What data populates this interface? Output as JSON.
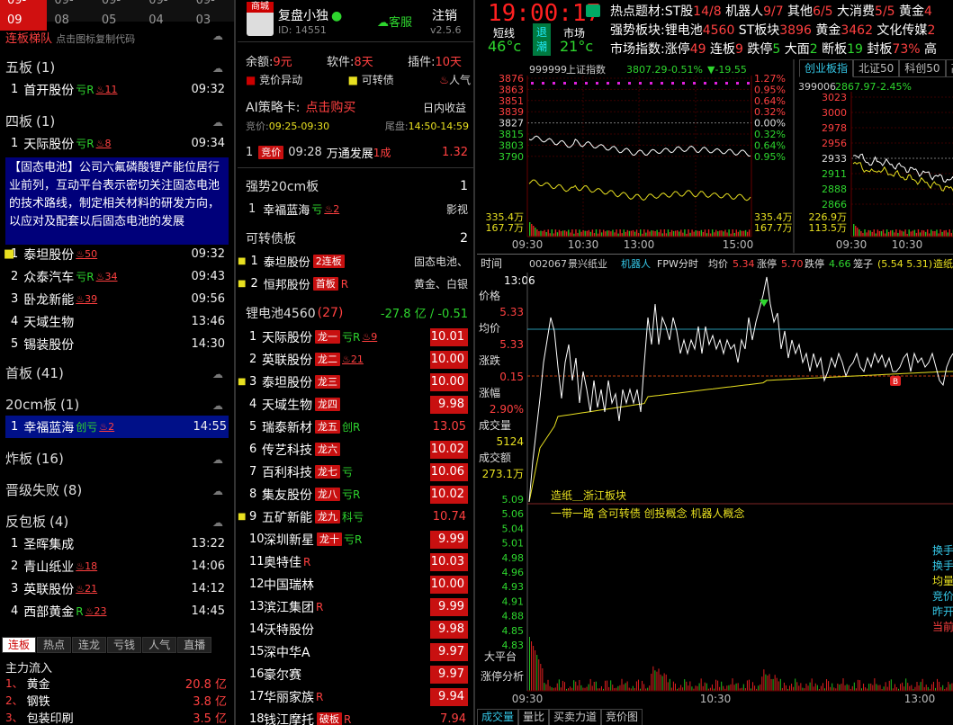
{
  "dates": [
    "09-09",
    "09-08",
    "09-05",
    "09-04",
    "09-03"
  ],
  "left": {
    "title": "连板梯队",
    "hint": "点击图标复制代码",
    "sections": [
      {
        "label": "五板",
        "count": "(1)",
        "items": [
          {
            "n": "1",
            "name": "首开股份",
            "flags": "亏R",
            "hot": "11",
            "time": "09:32"
          }
        ]
      },
      {
        "label": "四板",
        "count": "(1)",
        "items": [
          {
            "n": "1",
            "name": "天际股份",
            "flags": "亏R",
            "hot": "8",
            "time": "09:34"
          }
        ]
      },
      {
        "label": "三板",
        "count": "",
        "items": [
          {
            "n": "1",
            "name": "泰坦股份",
            "flags": "",
            "hot": "50",
            "time": "09:32"
          },
          {
            "n": "2",
            "name": "众泰汽车",
            "flags": "亏R",
            "hot": "34",
            "time": "09:43"
          },
          {
            "n": "3",
            "name": "卧龙新能",
            "flags": "",
            "hot": "39",
            "time": "09:56"
          },
          {
            "n": "4",
            "name": "天域生物",
            "flags": "",
            "hot": "",
            "time": "13:46"
          },
          {
            "n": "5",
            "name": "锡装股份",
            "flags": "",
            "hot": "",
            "time": "14:30"
          }
        ]
      },
      {
        "label": "首板",
        "count": "(41)"
      },
      {
        "label": "20cm板",
        "count": "(1)",
        "items": [
          {
            "n": "1",
            "name": "幸福蓝海",
            "flags": "创亏",
            "hot": "2",
            "time": "14:55"
          }
        ]
      },
      {
        "label": "炸板",
        "count": "(16)"
      },
      {
        "label": "晋级失败",
        "count": "(8)"
      },
      {
        "label": "反包板",
        "count": "(4)",
        "items": [
          {
            "n": "1",
            "name": "圣晖集成",
            "flags": "",
            "hot": "",
            "time": "13:22"
          },
          {
            "n": "2",
            "name": "青山纸业",
            "flags": "",
            "hot": "18",
            "time": "14:06"
          },
          {
            "n": "3",
            "name": "英联股份",
            "flags": "",
            "hot": "21",
            "time": "14:12"
          },
          {
            "n": "4",
            "name": "西部黄金",
            "flags": "R",
            "hot": "23",
            "time": "14:45"
          }
        ]
      }
    ],
    "tooltip": "【固态电池】公司六氟磷酸锂产能位居行业前列，互动平台表示密切关注固态电池的技术路线，制定相关材料的研发方向，以应对及配套以后固态电池的发展",
    "tabs": [
      "连板",
      "热点",
      "连龙",
      "亏钱",
      "人气",
      "直播"
    ],
    "flow_title": "主力流入",
    "flows": [
      {
        "n": "1、",
        "name": "黄金",
        "val": "20.8 亿"
      },
      {
        "n": "2、",
        "name": "钢铁",
        "val": "3.8 亿"
      },
      {
        "n": "3、",
        "name": "包装印刷",
        "val": "3.5 亿"
      }
    ]
  },
  "mid": {
    "app_name": "复盘小独",
    "badge": "商城",
    "user_id": "ID: 14551",
    "service": "客服",
    "logout": "注销",
    "version": "v2.5.6",
    "balance_label": "余额:",
    "balance": "9元",
    "software_label": "软件:",
    "software": "8天",
    "plugin_label": "插件:",
    "plugin": "10天",
    "legend": [
      "竞价异动",
      "可转债",
      "人气"
    ],
    "ai_label": "AI策略卡:",
    "ai_buy": "点击购买",
    "ai_intraday": "日内收益",
    "bid_label": "竞价:",
    "bid_time": "09:25-09:30",
    "tail_label": "尾盘:",
    "tail_time": "14:50-14:59",
    "bid_row": {
      "n": "1",
      "tag": "竞价",
      "time": "09:28",
      "name": "万通发展",
      "board": "1成",
      "val": "1.32"
    },
    "strong_title": "强势20cm板",
    "strong_count": "1",
    "strong_row": {
      "n": "1",
      "name": "幸福蓝海",
      "hot": "2",
      "extra": "影视"
    },
    "cb_title": "可转债板",
    "cb_count": "2",
    "cb_rows": [
      {
        "n": "1",
        "name": "泰坦股份",
        "tag": "2连板",
        "extra": "固态电池、"
      },
      {
        "n": "2",
        "name": "恒邦股份",
        "tag": "首板",
        "flag": "R",
        "extra": "黄金、白银"
      }
    ],
    "sector_title": "锂电池4560",
    "sector_count": "(27)",
    "sector_flow": "-27.8 亿",
    "sector_pct": "/ -0.51",
    "list": [
      {
        "n": "1",
        "name": "天际股份",
        "tag": "龙一",
        "flag": "亏R",
        "hot": "9",
        "val": "10.01",
        "box": true
      },
      {
        "n": "2",
        "name": "英联股份",
        "tag": "龙二",
        "flag": "",
        "hot": "21",
        "val": "10.00",
        "box": true
      },
      {
        "n": "3",
        "name": "泰坦股份",
        "tag": "龙三",
        "flag": "",
        "hot": "",
        "val": "10.00",
        "box": true
      },
      {
        "n": "4",
        "name": "天域生物",
        "tag": "龙四",
        "flag": "",
        "hot": "",
        "val": "9.98",
        "box": true
      },
      {
        "n": "5",
        "name": "瑞泰新材",
        "tag": "龙五",
        "flag": "创R",
        "hot": "",
        "val": "13.05",
        "box": false
      },
      {
        "n": "6",
        "name": "传艺科技",
        "tag": "龙六",
        "flag": "",
        "hot": "",
        "val": "10.02",
        "box": true
      },
      {
        "n": "7",
        "name": "百利科技",
        "tag": "龙七",
        "flag": "亏",
        "hot": "",
        "val": "10.06",
        "box": true
      },
      {
        "n": "8",
        "name": "集友股份",
        "tag": "龙八",
        "flag": "亏R",
        "hot": "",
        "val": "10.02",
        "box": true
      },
      {
        "n": "9",
        "name": "五矿新能",
        "tag": "龙九",
        "flag": "科亏",
        "hot": "",
        "val": "10.74",
        "box": false
      },
      {
        "n": "10",
        "name": "深圳新星",
        "tag": "龙十",
        "flag": "亏R",
        "hot": "",
        "val": "9.99",
        "box": true
      },
      {
        "n": "11",
        "name": "奥特佳",
        "tag": "",
        "flag": "R",
        "hot": "",
        "val": "10.03",
        "box": true
      },
      {
        "n": "12",
        "name": "中国瑞林",
        "tag": "",
        "flag": "",
        "hot": "",
        "val": "10.00",
        "box": true
      },
      {
        "n": "13",
        "name": "滨江集团",
        "tag": "",
        "flag": "R",
        "hot": "",
        "val": "9.99",
        "box": true
      },
      {
        "n": "14",
        "name": "沃特股份",
        "tag": "",
        "flag": "",
        "hot": "",
        "val": "9.98",
        "box": true
      },
      {
        "n": "15",
        "name": "深中华A",
        "tag": "",
        "flag": "",
        "hot": "",
        "val": "9.97",
        "box": true
      },
      {
        "n": "16",
        "name": "豪尔赛",
        "tag": "",
        "flag": "",
        "hot": "",
        "val": "9.97",
        "box": true
      },
      {
        "n": "17",
        "name": "华丽家族",
        "tag": "",
        "flag": "R",
        "hot": "",
        "val": "9.94",
        "box": true
      },
      {
        "n": "18",
        "name": "钱江摩托",
        "tag": "破板",
        "flag": "R",
        "hot": "",
        "val": "7.94",
        "box": false
      }
    ]
  },
  "right": {
    "clock": "19:00:17",
    "weather": "多云",
    "short_label": "短线",
    "short_temp": "46°c",
    "retreat": "退潮",
    "market_label": "市场",
    "market_temp": "21°c",
    "info": [
      [
        {
          "t": "热点题材:",
          "c": "white"
        },
        {
          "t": "ST股",
          "c": "white"
        },
        {
          "t": "14/8",
          "c": "red"
        },
        {
          "t": " 机器人",
          "c": "white"
        },
        {
          "t": "9/7",
          "c": "red"
        },
        {
          "t": " 其他",
          "c": "white"
        },
        {
          "t": "6/5",
          "c": "red"
        },
        {
          "t": " 大消费",
          "c": "white"
        },
        {
          "t": "5/5",
          "c": "red"
        },
        {
          "t": " 黄金",
          "c": "white"
        },
        {
          "t": "4",
          "c": "red"
        }
      ],
      [
        {
          "t": "强势板块:",
          "c": "white"
        },
        {
          "t": "锂电池",
          "c": "white"
        },
        {
          "t": "4560",
          "c": "red"
        },
        {
          "t": " ST板块",
          "c": "white"
        },
        {
          "t": "3896",
          "c": "red"
        },
        {
          "t": " 黄金",
          "c": "white"
        },
        {
          "t": "3462",
          "c": "red"
        },
        {
          "t": " 文化传媒",
          "c": "white"
        },
        {
          "t": "2",
          "c": "red"
        }
      ],
      [
        {
          "t": "市场指数:",
          "c": "white"
        },
        {
          "t": "涨停",
          "c": "white"
        },
        {
          "t": "49",
          "c": "red"
        },
        {
          "t": " 连板",
          "c": "white"
        },
        {
          "t": "9",
          "c": "red"
        },
        {
          "t": " 跌停",
          "c": "white"
        },
        {
          "t": "5",
          "c": "green"
        },
        {
          "t": " 大面",
          "c": "white"
        },
        {
          "t": "2",
          "c": "green"
        },
        {
          "t": " 断板",
          "c": "white"
        },
        {
          "t": "19",
          "c": "green"
        },
        {
          "t": " 封板",
          "c": "white"
        },
        {
          "t": "73%",
          "c": "red"
        },
        {
          "t": " 高",
          "c": "white"
        }
      ]
    ],
    "idx1": {
      "code": "999999",
      "name": "上证指数",
      "price": "3807.29",
      "pct": "-0.51%",
      "chg": "▼-19.55",
      "left_ticks": [
        "3876",
        "3863",
        "3851",
        "3839",
        "3827",
        "3815",
        "3803",
        "3790"
      ],
      "right_ticks": [
        "1.27%",
        "0.95%",
        "0.64%",
        "0.32%",
        "0.00%",
        "0.32%",
        "0.64%",
        "0.95%"
      ],
      "vol_ticks": [
        "335.4万",
        "167.7万"
      ],
      "times": [
        "09:30",
        "10:30",
        "13:00",
        "15:00"
      ]
    },
    "tabs2": [
      "创业板指",
      "北证50",
      "科创50",
      "高"
    ],
    "idx2": {
      "code": "399006",
      "price": "2867.97",
      "pct": "-2.45%",
      "left_ticks": [
        "3023",
        "3000",
        "2978",
        "2956",
        "2933",
        "2911",
        "2888",
        "2866"
      ],
      "vol_ticks": [
        "226.9万",
        "113.5万"
      ],
      "times": [
        "09:30",
        "10:30"
      ]
    },
    "stock": {
      "time_label": "时间",
      "time": "13:06",
      "code": "002067",
      "name": "景兴纸业",
      "concept": "机器人",
      "fpw": "FPW分时",
      "avg_label": "均价",
      "avg": "5.34",
      "up_label": "涨停",
      "up": "5.70",
      "down_label": "跌停",
      "down": "4.66",
      "cage_label": "笼子",
      "cage": "(5.54 5.31)",
      "extra": "造纸",
      "side": [
        {
          "l": "价格",
          "v": "5.33"
        },
        {
          "l": "均价",
          "v": "5.33"
        },
        {
          "l": "涨跌",
          "v": "0.15"
        },
        {
          "l": "涨幅",
          "v": "2.90%"
        },
        {
          "l": "成交量",
          "v": "5124"
        },
        {
          "l": "成交额",
          "v": "273.1万"
        }
      ],
      "ticks": [
        "5.09",
        "5.06",
        "5.04",
        "5.01",
        "4.98",
        "4.96",
        "4.93",
        "4.91",
        "4.88",
        "4.85",
        "4.83"
      ],
      "sector": "造纸＿浙江板块",
      "concepts": "一带一路 含可转债 创投概念 机器人概念",
      "right_labels": [
        "换手",
        "换手",
        "均量",
        "竞价",
        "昨开",
        "当前"
      ],
      "bottom_labels": [
        "大平台",
        "涨停分析"
      ],
      "times": [
        "09:30",
        "10:30",
        "13:00"
      ],
      "tabs": [
        "成交量",
        "量比",
        "买卖力道",
        "竞价图"
      ]
    }
  }
}
